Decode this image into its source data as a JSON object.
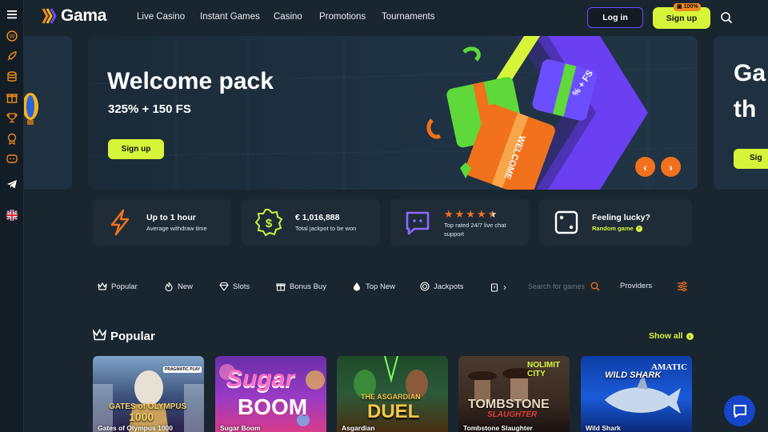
{
  "app": {
    "name": "Gama"
  },
  "nav": {
    "items": [
      "Live Casino",
      "Instant Games",
      "Casino",
      "Promotions",
      "Tournaments"
    ],
    "login_label": "Log in",
    "signup_label": "Sign up",
    "signup_badge": "100%"
  },
  "sidebar": {
    "icons": [
      "menu-icon",
      "coin-icon",
      "rocket-icon",
      "database-icon",
      "gift-icon",
      "trophy-icon",
      "medal-icon",
      "controller-icon",
      "telegram-icon",
      "uk-flag-icon"
    ]
  },
  "banner": {
    "title": "Welcome pack",
    "subtitle": "325% + 150 FS",
    "cta": "Sign up",
    "next_slide_title_fragment_1": "Ga",
    "next_slide_title_fragment_2": "th",
    "next_slide_cta_fragment": "Sig",
    "gift_label": "WELCOME",
    "gift_label_2": "% + FS"
  },
  "features": [
    {
      "title": "Up to 1 hour",
      "subtitle": "Average withdraw time",
      "icon": "lightning-icon"
    },
    {
      "title": "€  1,016,888",
      "subtitle": "Total jackpot to be won",
      "icon": "dollar-badge-icon"
    },
    {
      "title": "",
      "subtitle_1": "Top rated 24/7 live chat",
      "subtitle_2": "support",
      "rating_stars": 4.5,
      "icon": "chat-bubble-icon"
    },
    {
      "title": "Feeling lucky?",
      "subtitle": "Random game",
      "icon": "dice-icon"
    }
  ],
  "categories": [
    "Popular",
    "New",
    "Slots",
    "Bonus Buy",
    "Top New",
    "Jackpots"
  ],
  "search": {
    "placeholder": "Search for games"
  },
  "providers_label": "Providers",
  "popular": {
    "title": "Popular",
    "show_all": "Show all",
    "games": [
      {
        "name": "Gates of Olympus 1000",
        "art_text_1": "GATES of OLYMPUS",
        "art_text_2": "1000",
        "provider": "PRAGMATIC PLAY"
      },
      {
        "name": "Sugar Boom",
        "art_text_1": "Sugar",
        "art_text_2": "BOOM",
        "provider": ""
      },
      {
        "name": "Asgardian",
        "art_text_1": "THE ASGARDIAN",
        "art_text_2": "DUEL",
        "provider": ""
      },
      {
        "name": "Tombstone Slaughter",
        "art_text_1": "TOMBSTONE",
        "art_text_2": "SLAUGHTER",
        "provider": "NOLIMIT CITY"
      },
      {
        "name": "Wild Shark",
        "art_text_1": "WILD SHARK",
        "art_text_2": "",
        "provider": "AMATIC"
      }
    ]
  },
  "colors": {
    "accent": "#d6f53a",
    "orange": "#f08a1c",
    "purple": "#6b4eff",
    "background": "#19252f",
    "card": "#1f2c38"
  }
}
